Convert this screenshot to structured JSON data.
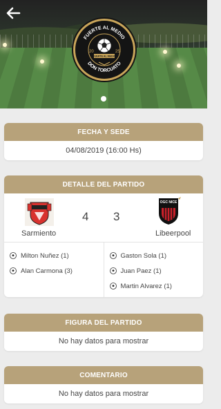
{
  "header": {
    "back_icon": "back-arrow-icon",
    "badge": {
      "top_text": "FUERTE AL MEDIO",
      "year_left": "20",
      "year_right": "25",
      "ribbon_text": "FUERTE AL MEDIO",
      "bottom_text": "DON TORCUATO"
    }
  },
  "colors": {
    "accent": "#b7a27a",
    "badge_gold": "#c9a55a"
  },
  "sections": {
    "fecha": {
      "title": "FECHA Y SEDE",
      "value": "04/08/2019 (16:00 Hs)"
    },
    "detalle": {
      "title": "DETALLE DEL PARTIDO",
      "home": {
        "name": "Sarmiento",
        "score": "4"
      },
      "away": {
        "name": "Libeerpool",
        "score": "3",
        "logo_text": "OGC NICE"
      },
      "home_scorers": [
        "Milton Nuñez (1)",
        "Alan Carmona (3)"
      ],
      "away_scorers": [
        "Gaston Sola (1)",
        "Juan Paez (1)",
        "Martin Alvarez (1)"
      ]
    },
    "figura": {
      "title": "FIGURA DEL PARTIDO",
      "value": "No hay datos para mostrar"
    },
    "comentario": {
      "title": "COMENTARIO",
      "value": "No hay datos para mostrar"
    }
  }
}
